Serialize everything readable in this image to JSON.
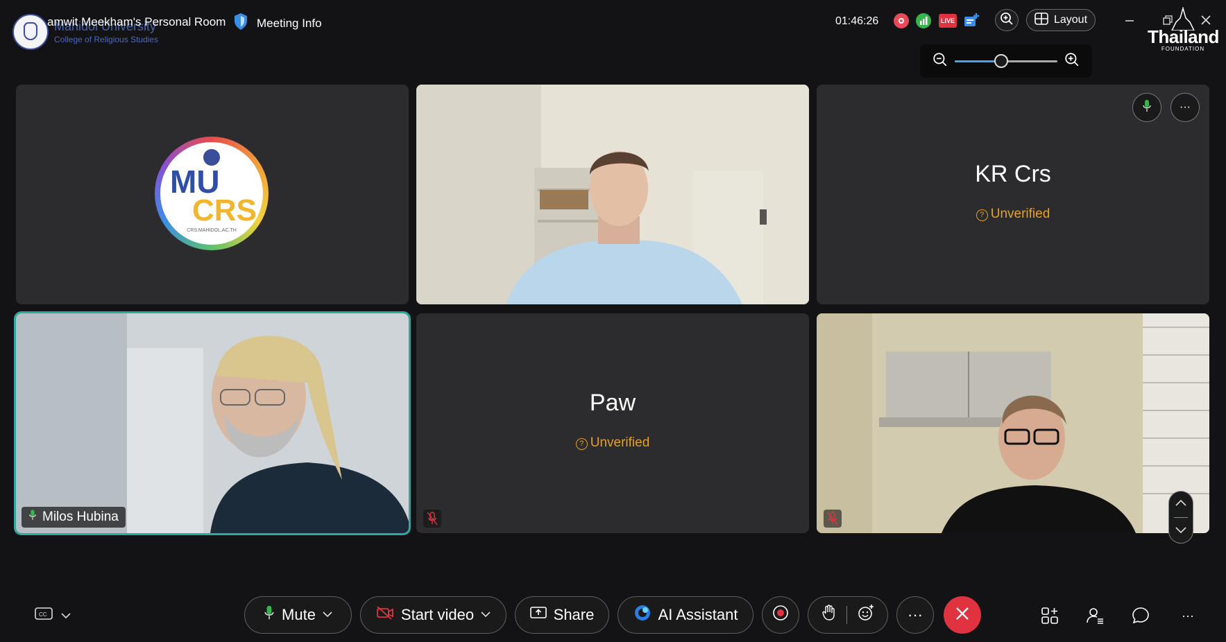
{
  "header": {
    "university_name": "Mahidol University",
    "university_sub": "College of Religious Studies",
    "room_title": "amwit Meekham's Personal Room",
    "meeting_info_label": "Meeting Info",
    "timer": "01:46:26",
    "live_badge": "LIVE",
    "layout_label": "Layout",
    "zoom_level": 0.45,
    "sponsor_logo_text": "Thailand",
    "sponsor_logo_sub": "FOUNDATION"
  },
  "tiles": [
    {
      "type": "logo",
      "logo_top": "MU",
      "logo_bottom": "CRS",
      "logo_url_text": "CRS.MAHIDOL.AC.TH"
    },
    {
      "type": "video",
      "description_icon": "person-video"
    },
    {
      "type": "name",
      "name": "KR Crs",
      "status": "Unverified"
    },
    {
      "type": "video",
      "name": "Milos Hubina",
      "active": true
    },
    {
      "type": "name",
      "name": "Paw",
      "status": "Unverified",
      "muted": true
    },
    {
      "type": "video",
      "muted": true
    }
  ],
  "toolbar": {
    "mute_label": "Mute",
    "start_video_label": "Start video",
    "share_label": "Share",
    "ai_assistant_label": "AI Assistant"
  },
  "colors": {
    "accent_teal": "#2fa9a0",
    "unverified": "#e3a127",
    "end_call": "#e0333f",
    "background": "#131315",
    "tile": "#2c2c2e"
  }
}
